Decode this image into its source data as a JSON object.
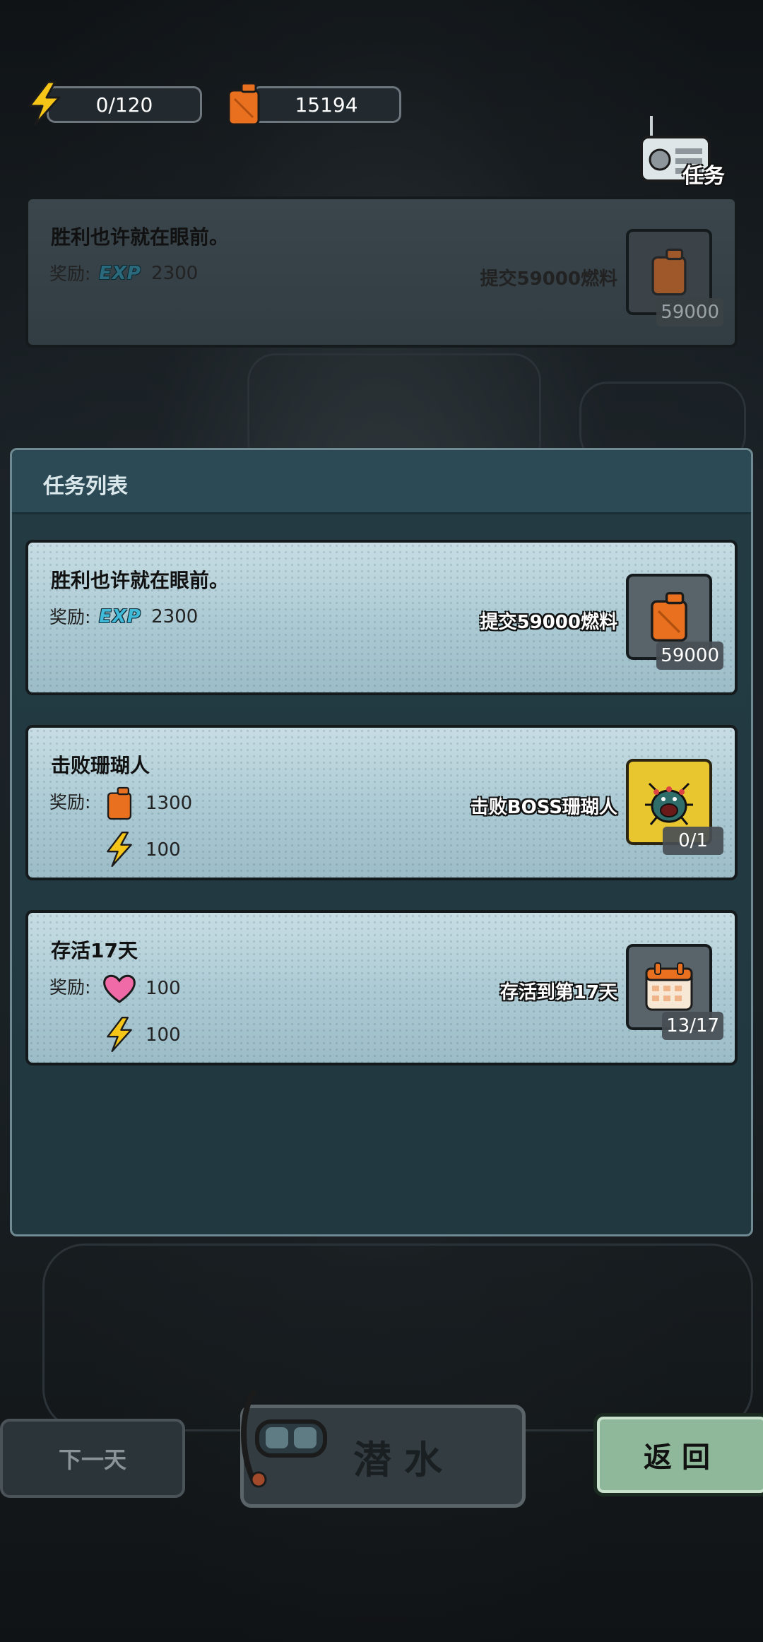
{
  "header": {
    "energy": "0/120",
    "fuel": "15194",
    "radio_label": "任务"
  },
  "active_task": {
    "title": "胜利也许就在眼前。",
    "reward_label": "奖励:",
    "reward_exp_tag": "EXP",
    "reward_exp_value": "2300",
    "goal": "提交59000燃料",
    "progress": "59000"
  },
  "panel": {
    "title": "任务列表"
  },
  "tasks": [
    {
      "title": "胜利也许就在眼前。",
      "reward_label": "奖励:",
      "rewards": [
        {
          "icon": "exp-icon",
          "tag": "EXP",
          "value": "2300"
        }
      ],
      "goal": "提交59000燃料",
      "progress": "59000",
      "target_icon": "fuel-can-icon"
    },
    {
      "title": "击败珊瑚人",
      "reward_label": "奖励:",
      "rewards": [
        {
          "icon": "fuel-icon",
          "value": "1300"
        },
        {
          "icon": "lightning-icon",
          "value": "100"
        }
      ],
      "goal": "击败BOSS珊瑚人",
      "progress": "0/1",
      "target_icon": "coral-boss-icon"
    },
    {
      "title": "存活17天",
      "reward_label": "奖励:",
      "rewards": [
        {
          "icon": "heart-icon",
          "value": "100"
        },
        {
          "icon": "lightning-icon",
          "value": "100"
        }
      ],
      "goal": "存活到第17天",
      "progress": "13/17",
      "target_icon": "calendar-icon"
    }
  ],
  "bottom": {
    "next_day": "下一天",
    "dive": "潜水",
    "back": "返回"
  },
  "colors": {
    "card_bg": "#aac9d3",
    "panel_bg": "#233a42",
    "back_button": "#8fb89a"
  }
}
